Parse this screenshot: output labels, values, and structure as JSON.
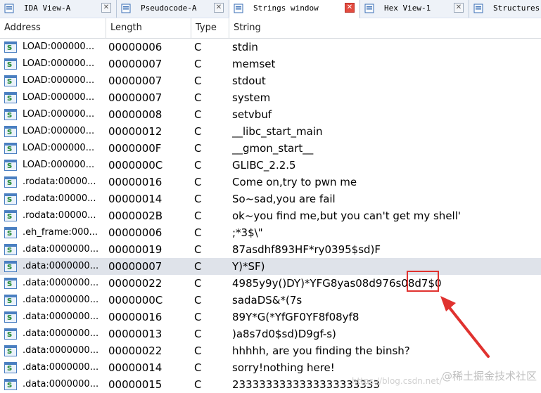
{
  "tabs": [
    {
      "label": "IDA View-A",
      "icon": "ida-view-icon",
      "active": false
    },
    {
      "label": "Pseudocode-A",
      "icon": "pseudocode-icon",
      "active": false
    },
    {
      "label": "Strings window",
      "icon": "strings-icon",
      "active": true
    },
    {
      "label": "Hex View-1",
      "icon": "hex-view-icon",
      "active": false
    },
    {
      "label": "Structures",
      "icon": "structures-icon",
      "active": false
    }
  ],
  "columns": {
    "address": "Address",
    "length": "Length",
    "type": "Type",
    "string": "String"
  },
  "rows": [
    {
      "address": "LOAD:000000...",
      "length": "00000006",
      "type": "C",
      "string": "stdin"
    },
    {
      "address": "LOAD:000000...",
      "length": "00000007",
      "type": "C",
      "string": "memset"
    },
    {
      "address": "LOAD:000000...",
      "length": "00000007",
      "type": "C",
      "string": "stdout"
    },
    {
      "address": "LOAD:000000...",
      "length": "00000007",
      "type": "C",
      "string": "system"
    },
    {
      "address": "LOAD:000000...",
      "length": "00000008",
      "type": "C",
      "string": "setvbuf"
    },
    {
      "address": "LOAD:000000...",
      "length": "00000012",
      "type": "C",
      "string": "__libc_start_main"
    },
    {
      "address": "LOAD:000000...",
      "length": "0000000F",
      "type": "C",
      "string": "__gmon_start__"
    },
    {
      "address": "LOAD:000000...",
      "length": "0000000C",
      "type": "C",
      "string": "GLIBC_2.2.5"
    },
    {
      "address": ".rodata:00000...",
      "length": "00000016",
      "type": "C",
      "string": "Come on,try to pwn me"
    },
    {
      "address": ".rodata:00000...",
      "length": "00000014",
      "type": "C",
      "string": "So~sad,you are fail"
    },
    {
      "address": ".rodata:00000...",
      "length": "0000002B",
      "type": "C",
      "string": "ok~you find me,but you can't get my shell'"
    },
    {
      "address": ".eh_frame:000...",
      "length": "00000006",
      "type": "C",
      "string": ";*3$\\\""
    },
    {
      "address": ".data:0000000...",
      "length": "00000019",
      "type": "C",
      "string": "87asdhf893HF*ry0395$sd)F"
    },
    {
      "address": ".data:0000000...",
      "length": "00000007",
      "type": "C",
      "string": "Y)*SF)",
      "selected": true
    },
    {
      "address": ".data:0000000...",
      "length": "00000022",
      "type": "C",
      "string": "4985y9y()DY)*YFG8yas08d976s08d7$0"
    },
    {
      "address": ".data:0000000...",
      "length": "0000000C",
      "type": "C",
      "string": "sadaDS&*(7s"
    },
    {
      "address": ".data:0000000...",
      "length": "00000016",
      "type": "C",
      "string": "89Y*G(*YfGF0YF8f08yf8"
    },
    {
      "address": ".data:0000000...",
      "length": "00000013",
      "type": "C",
      "string": ")a8s7d0$sd)D9gf-s)"
    },
    {
      "address": ".data:0000000...",
      "length": "00000022",
      "type": "C",
      "string": "hhhhh, are you finding the binsh?"
    },
    {
      "address": ".data:0000000...",
      "length": "00000014",
      "type": "C",
      "string": "sorry!nothing here!"
    },
    {
      "address": ".data:0000000...",
      "length": "00000015",
      "type": "C",
      "string": "2333333333333333333333"
    }
  ],
  "watermark": "@稀土掘金技术社区",
  "watermark_url": "https://blog.csdn.net/"
}
